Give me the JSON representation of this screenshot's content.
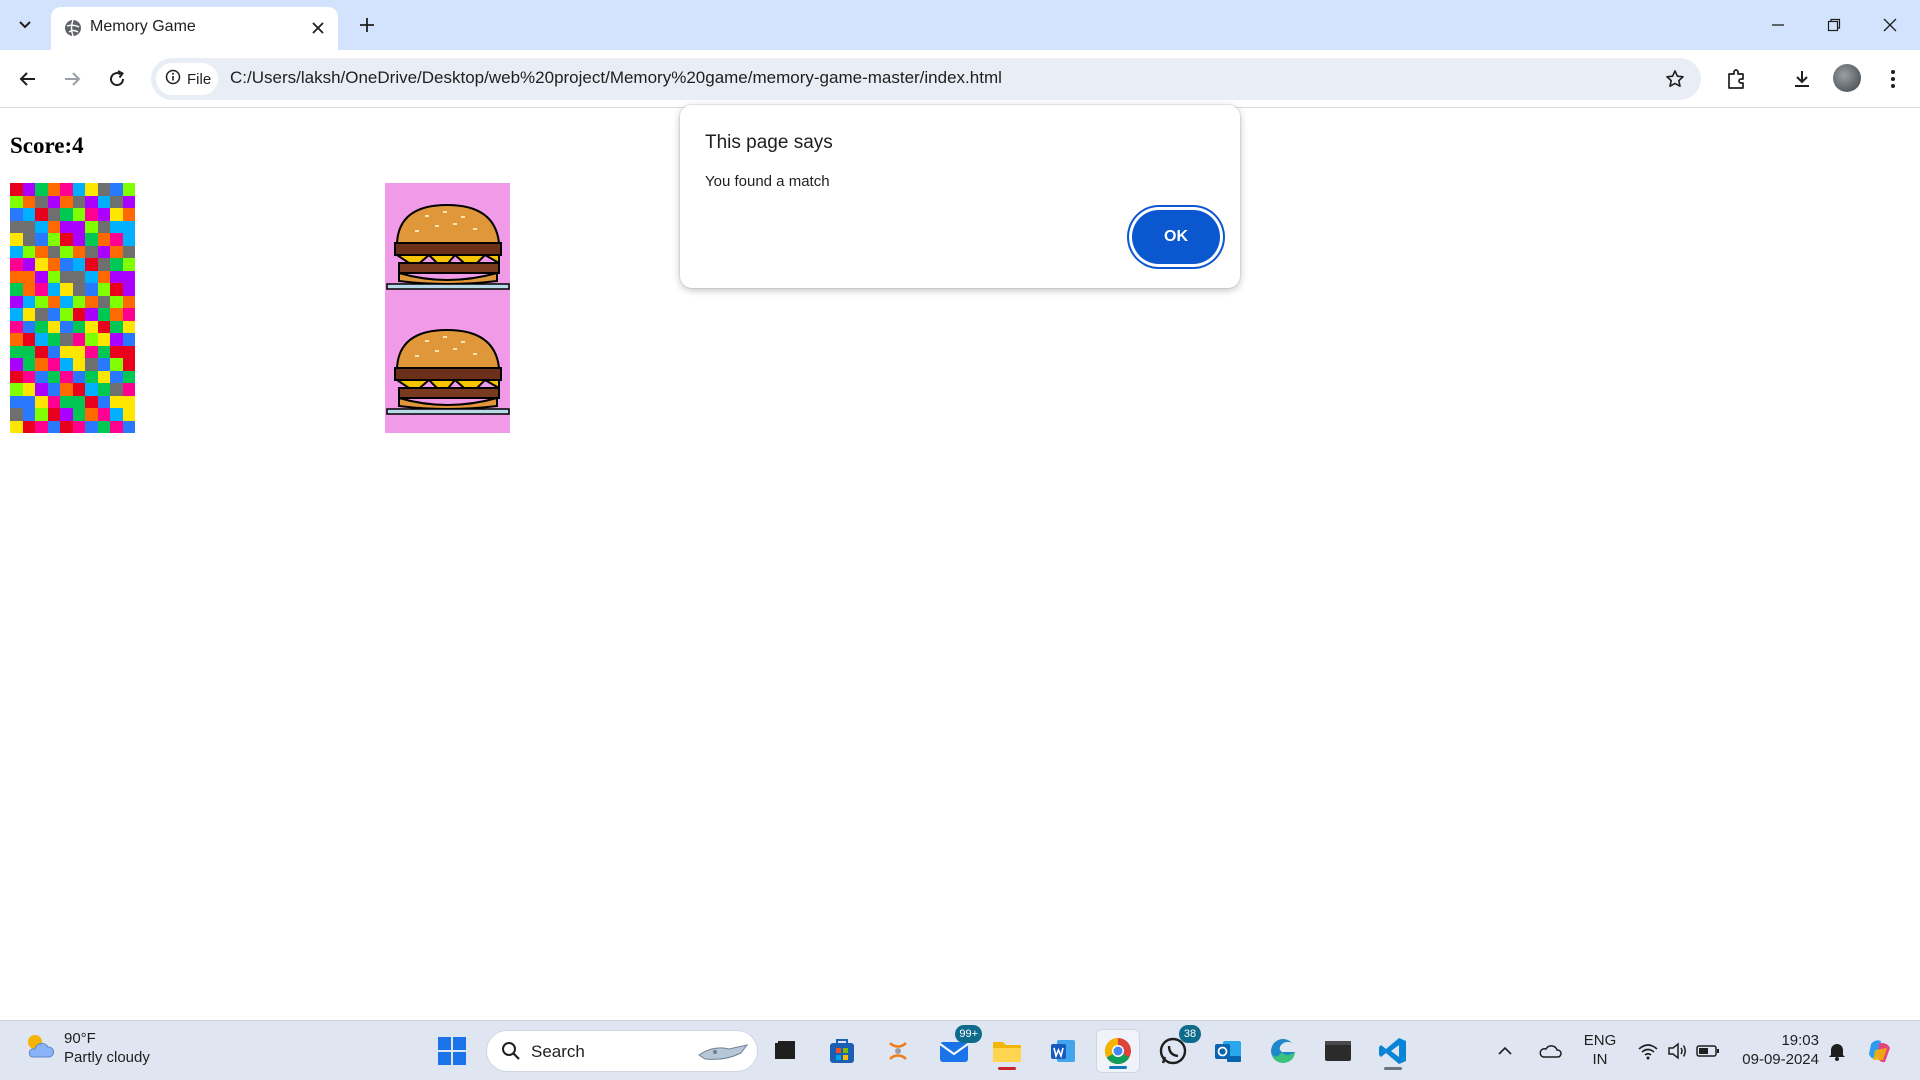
{
  "browser": {
    "tab_title": "Memory Game",
    "site_chip_label": "File",
    "url": "C:/Users/laksh/OneDrive/Desktop/web%20project/Memory%20game/memory-game-master/index.html"
  },
  "page": {
    "score_text": "Score:4"
  },
  "dialog": {
    "title": "This page says",
    "message": "You found a match",
    "ok_label": "OK"
  },
  "taskbar": {
    "weather_temp": "90°F",
    "weather_desc": "Partly cloudy",
    "search_label": "Search",
    "mail_badge": "99+",
    "whatsapp_badge": "38",
    "lang_top": "ENG",
    "lang_bottom": "IN",
    "time": "19:03",
    "date": "09-09-2024"
  },
  "colors": {
    "accent": "#0b57d0",
    "tabstrip": "#d3e3fd",
    "burger_card_bg": "#f19ae8"
  }
}
